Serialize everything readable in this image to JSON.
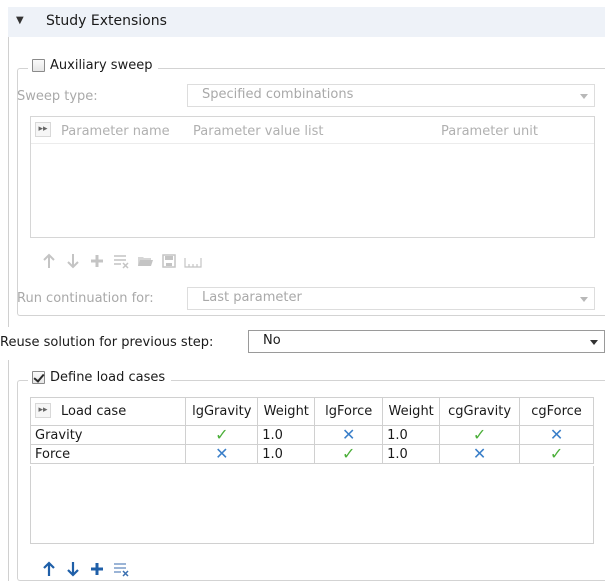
{
  "header": {
    "title": "Study Extensions"
  },
  "aux_sweep": {
    "label": "Auxiliary sweep",
    "checked": false,
    "sweep_type_label": "Sweep type:",
    "sweep_type_value": "Specified combinations",
    "columns": [
      "Parameter name",
      "Parameter value list",
      "Parameter unit"
    ],
    "run_continuation_label": "Run continuation for:",
    "run_continuation_value": "Last parameter"
  },
  "reuse": {
    "label": "Reuse solution for previous step:",
    "value": "No"
  },
  "load_cases": {
    "label": "Define load cases",
    "checked": true,
    "columns": [
      "Load case",
      "lgGravity",
      "Weight",
      "lgForce",
      "Weight",
      "cgGravity",
      "cgForce"
    ],
    "rows": [
      {
        "name": "Gravity",
        "lgGravity": "check",
        "weight1": "1.0",
        "lgForce": "cross",
        "weight2": "1.0",
        "cgGravity": "check",
        "cgForce": "cross"
      },
      {
        "name": "Force",
        "lgGravity": "cross",
        "weight1": "1.0",
        "lgForce": "check",
        "weight2": "1.0",
        "cgGravity": "cross",
        "cgForce": "check"
      }
    ]
  },
  "colors": {
    "check": "#4caf3a",
    "cross": "#3a7fc9",
    "header_bg": "#eef2f8"
  }
}
